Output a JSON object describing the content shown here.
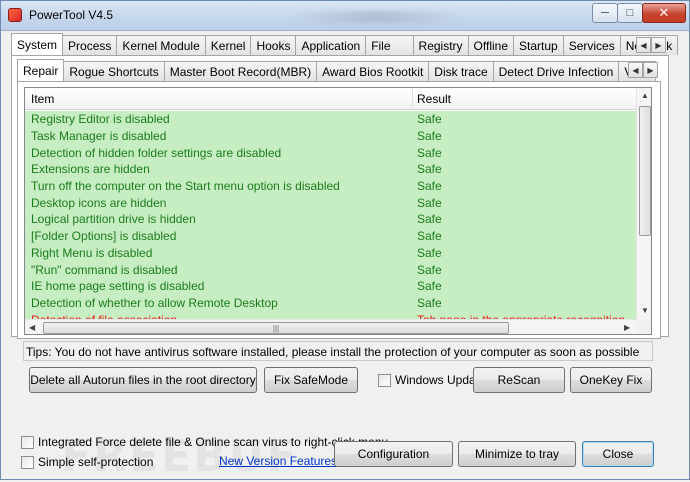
{
  "window": {
    "title": "PowerTool V4.5"
  },
  "main_tabs": [
    "System",
    "Process",
    "Kernel Module",
    "Kernel",
    "Hooks",
    "Application",
    "File",
    "Registry",
    "Offline",
    "Startup",
    "Services",
    "NetWork"
  ],
  "sub_tabs": [
    "Repair",
    "Rogue Shortcuts",
    "Master Boot Record(MBR)",
    "Award Bios Rootkit",
    "Disk trace",
    "Detect Drive Infection",
    "VBR b"
  ],
  "list": {
    "columns": {
      "item": "Item",
      "result": "Result"
    },
    "rows": [
      {
        "item": "Registry Editor is disabled",
        "result": "Safe"
      },
      {
        "item": "Task Manager is disabled",
        "result": "Safe"
      },
      {
        "item": "Detection of hidden folder settings are disabled",
        "result": "Safe"
      },
      {
        "item": "Extensions are hidden",
        "result": "Safe"
      },
      {
        "item": "Turn off the computer on the Start menu option is disabled",
        "result": "Safe"
      },
      {
        "item": "Desktop icons are hidden",
        "result": "Safe"
      },
      {
        "item": "Logical partition drive is hidden",
        "result": "Safe"
      },
      {
        "item": "[Folder Options] is disabled",
        "result": "Safe"
      },
      {
        "item": "Right Menu is disabled",
        "result": "Safe"
      },
      {
        "item": "\"Run\" command is disabled",
        "result": "Safe"
      },
      {
        "item": "IE home page setting is disabled",
        "result": "Safe"
      },
      {
        "item": "Detection of whether to allow Remote Desktop",
        "result": "Safe"
      },
      {
        "item": "Detection of file association",
        "result": "Tab page in the appropriate recognition"
      }
    ]
  },
  "tips": "Tips: You do not have antivirus software installed, please install the protection of your computer as soon as possible",
  "buttons": {
    "delete_autorun": "Delete all Autorun files in the root directory",
    "fix_safemode": "Fix SafeMode",
    "rescan": "ReScan",
    "onekey_fix": "OneKey Fix",
    "configuration": "Configuration",
    "minimize_tray": "Minimize to tray",
    "close": "Close"
  },
  "checkboxes": {
    "windows_update": "Windows Updat",
    "integrated_force": "Integrated Force delete file & Online scan virus to right-click menu",
    "simple_self_protection": "Simple self-protection"
  },
  "links": {
    "new_version": "New Version Features"
  },
  "colors": {
    "safe_text": "#1a7d1a",
    "warn_text": "#e81a1a",
    "row_bg": "#c7edc3"
  }
}
